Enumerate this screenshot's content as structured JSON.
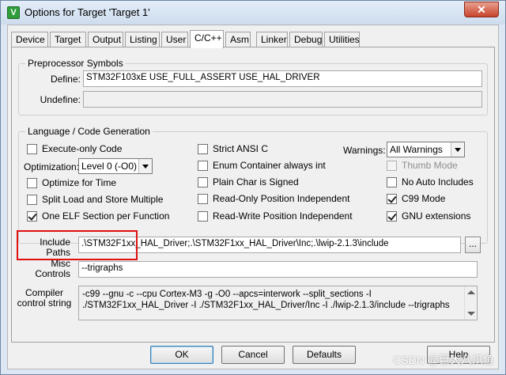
{
  "window": {
    "title": "Options for Target 'Target 1'",
    "icon_label": "V",
    "close_glyph": "✕"
  },
  "tabs": [
    {
      "label": "Device"
    },
    {
      "label": "Target"
    },
    {
      "label": "Output"
    },
    {
      "label": "Listing"
    },
    {
      "label": "User"
    },
    {
      "label": "C/C++",
      "active": true
    },
    {
      "label": "Asm"
    },
    {
      "label": "Linker"
    },
    {
      "label": "Debug"
    },
    {
      "label": "Utilities"
    }
  ],
  "preprocessor": {
    "legend": "Preprocessor Symbols",
    "define_label": "Define:",
    "define_value": "STM32F103xE USE_FULL_ASSERT USE_HAL_DRIVER",
    "undefine_label": "Undefine:",
    "undefine_value": ""
  },
  "language": {
    "legend": "Language / Code Generation",
    "execute_only": {
      "label": "Execute-only Code",
      "checked": false
    },
    "optimization_label": "Optimization:",
    "optimization_value": "Level 0 (-O0)",
    "optimize_time": {
      "label": "Optimize for Time",
      "checked": false
    },
    "split_load": {
      "label": "Split Load and Store Multiple",
      "checked": false
    },
    "one_elf": {
      "label": "One ELF Section per Function",
      "checked": true
    },
    "strict_ansi": {
      "label": "Strict ANSI C",
      "checked": false
    },
    "enum_container": {
      "label": "Enum Container always int",
      "checked": false
    },
    "plain_char": {
      "label": "Plain Char is Signed",
      "checked": false
    },
    "ro_position": {
      "label": "Read-Only Position Independent",
      "checked": false
    },
    "rw_position": {
      "label": "Read-Write Position Independent",
      "checked": false
    },
    "warnings_label": "Warnings:",
    "warnings_value": "All Warnings",
    "thumb_mode": {
      "label": "Thumb Mode",
      "checked": false,
      "disabled": true
    },
    "no_auto_includes": {
      "label": "No Auto Includes",
      "checked": false
    },
    "c99_mode": {
      "label": "C99 Mode",
      "checked": true
    },
    "gnu_extensions": {
      "label": "GNU extensions",
      "checked": true
    }
  },
  "include_paths": {
    "label": "Include Paths",
    "value": ".\\STM32F1xx_HAL_Driver;.\\STM32F1xx_HAL_Driver\\Inc;.\\lwip-2.1.3\\include",
    "browse_label": "..."
  },
  "misc_controls": {
    "label": "Misc Controls",
    "value": "--trigraphs"
  },
  "compiler_control": {
    "label": "Compiler control string",
    "value": "-c99 --gnu -c --cpu Cortex-M3 -g -O0 --apcs=interwork --split_sections -I ./STM32F1xx_HAL_Driver -I ./STM32F1xx_HAL_Driver/Inc -I ./lwip-2.1.3/include --trigraphs"
  },
  "buttons": {
    "ok": "OK",
    "cancel": "Cancel",
    "defaults": "Defaults",
    "help": "Help"
  },
  "watermark": "CSDN @巨大八爪鱼"
}
